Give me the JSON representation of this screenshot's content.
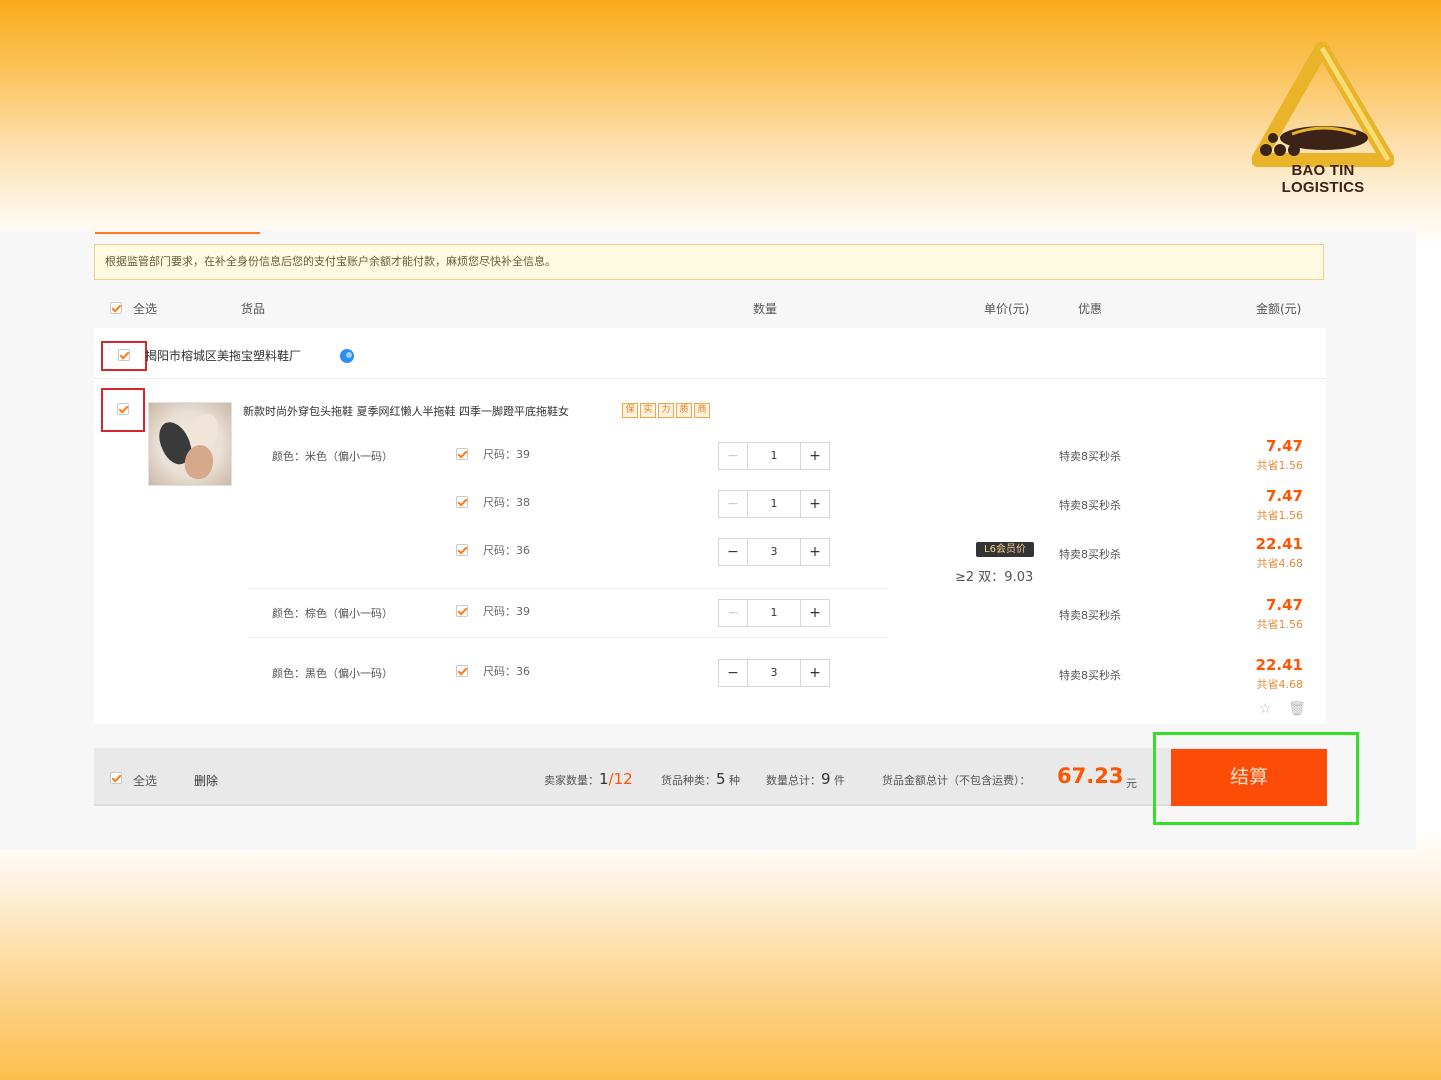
{
  "logo": {
    "text": "BAO TIN LOGISTICS"
  },
  "notice": "根据监管部门要求，在补全身份信息后您的支付宝账户余额才能付款，麻烦您尽快补全信息。",
  "header": {
    "select_all": "全选",
    "goods": "货品",
    "quantity": "数量",
    "unit_price": "单价(元)",
    "discount": "优惠",
    "amount": "金额(元)"
  },
  "shop": {
    "name": "揭阳市榕城区美拖宝塑料鞋厂"
  },
  "product": {
    "title": "新款时尚外穿包头拖鞋 夏季网红懒人半拖鞋 四季一脚蹬平底拖鞋女",
    "badges": [
      "保",
      "实",
      "力",
      "质",
      "商"
    ]
  },
  "colors": {
    "beige": "颜色：米色（偏小一码）",
    "brown": "颜色：棕色（偏小一码）",
    "black": "颜色：黑色（偏小一码）"
  },
  "rows": [
    {
      "size": "尺码：39",
      "qty": "1",
      "minus": "−",
      "plus": "+",
      "promo": "特卖8买秒杀",
      "price": "7.47",
      "save": "共省1.56"
    },
    {
      "size": "尺码：38",
      "qty": "1",
      "minus": "−",
      "plus": "+",
      "promo": "特卖8买秒杀",
      "price": "7.47",
      "save": "共省1.56"
    },
    {
      "size": "尺码：36",
      "qty": "3",
      "minus": "−",
      "plus": "+",
      "promo": "特卖8买秒杀",
      "price": "22.41",
      "save": "共省4.68"
    },
    {
      "size": "尺码：39",
      "qty": "1",
      "minus": "−",
      "plus": "+",
      "promo": "特卖8买秒杀",
      "price": "7.47",
      "save": "共省1.56"
    },
    {
      "size": "尺码：36",
      "qty": "3",
      "minus": "−",
      "plus": "+",
      "promo": "特卖8买秒杀",
      "price": "22.41",
      "save": "共省4.68"
    }
  ],
  "vip": {
    "badge": "L6会员价",
    "tier": "≥2 双：9.03"
  },
  "row_icons": {
    "star": "☆",
    "trash": "🗑"
  },
  "footer": {
    "select_all": "全选",
    "delete": "删除",
    "sellers_label": "卖家数量：",
    "sellers_value": "1",
    "sellers_total": "/12",
    "kinds_label": "货品种类：",
    "kinds_value": "5",
    "kinds_unit": "种",
    "qty_label": "数量总计：",
    "qty_value": "9",
    "qty_unit": "件",
    "total_label": "货品金额总计（不包含运费）：",
    "total_value": "67.23",
    "total_unit": "元",
    "checkout": "结算"
  },
  "colors_theme": {
    "accent": "#ff5500",
    "checkout_bg": "#fd4b08",
    "highlight_red": "#d9262d",
    "highlight_green": "#35e029"
  }
}
